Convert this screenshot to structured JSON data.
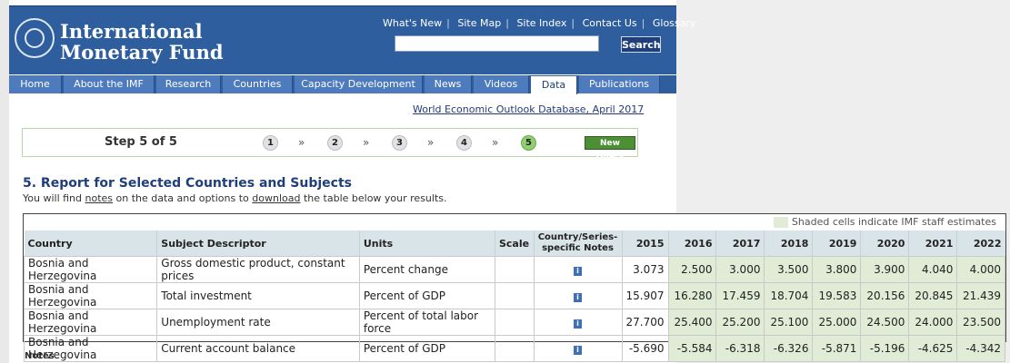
{
  "header": {
    "org_line1": "International",
    "org_line2": "Monetary Fund",
    "links": [
      "What's New",
      "Site Map",
      "Site Index",
      "Contact Us",
      "Glossary"
    ],
    "search_button": "Search",
    "search_value": ""
  },
  "nav": {
    "tabs": [
      "Home",
      "About the IMF",
      "Research",
      "Countries",
      "Capacity Development",
      "News",
      "Videos",
      "Data",
      "Publications"
    ],
    "active": "Data"
  },
  "database_link": "World Economic Outlook Database, April 2017",
  "steps": {
    "label": "Step 5 of 5",
    "numbers": [
      "1",
      "2",
      "3",
      "4",
      "5"
    ],
    "separator": "»",
    "new_query": "New Query"
  },
  "report": {
    "title": "5. Report for Selected Countries and Subjects",
    "intro_prefix": "You will find ",
    "intro_notes": "notes",
    "intro_middle": " on the data and options to ",
    "intro_download": "download",
    "intro_suffix": " the table below your results."
  },
  "table": {
    "shade_note": "Shaded cells indicate IMF staff estimates",
    "headers": {
      "country": "Country",
      "subject": "Subject Descriptor",
      "units": "Units",
      "scale": "Scale",
      "notes_line1": "Country/Series-",
      "notes_line2": "specific Notes",
      "years": [
        "2015",
        "2016",
        "2017",
        "2018",
        "2019",
        "2020",
        "2021",
        "2022"
      ]
    },
    "info_glyph": "i",
    "rows": [
      {
        "country": "Bosnia and Herzegovina",
        "subject": "Gross domestic product, constant prices",
        "units": "Percent change",
        "scale": "",
        "values": [
          "3.073",
          "2.500",
          "3.000",
          "3.500",
          "3.800",
          "3.900",
          "4.040",
          "4.000"
        ]
      },
      {
        "country": "Bosnia and Herzegovina",
        "subject": "Total investment",
        "units": "Percent of GDP",
        "scale": "",
        "values": [
          "15.907",
          "16.280",
          "17.459",
          "18.704",
          "19.583",
          "20.156",
          "20.845",
          "21.439"
        ]
      },
      {
        "country": "Bosnia and Herzegovina",
        "subject": "Unemployment rate",
        "units": "Percent of total labor force",
        "scale": "",
        "values": [
          "27.700",
          "25.400",
          "25.200",
          "25.100",
          "25.000",
          "24.500",
          "24.000",
          "23.500"
        ]
      },
      {
        "country": "Bosnia and Herzegovina",
        "subject": "Current account balance",
        "units": "Percent of GDP",
        "scale": "",
        "values": [
          "-5.690",
          "-5.584",
          "-6.318",
          "-6.326",
          "-5.871",
          "-5.196",
          "-4.625",
          "-4.342"
        ]
      }
    ]
  },
  "notes_heading": "Notes",
  "colors": {
    "header_blue": "#2f5e9e",
    "tab_blue": "#4d7bbd",
    "estimate_shade": "#e0ecd6",
    "step_current": "#8fcf71",
    "new_query_green": "#4d8f34"
  }
}
